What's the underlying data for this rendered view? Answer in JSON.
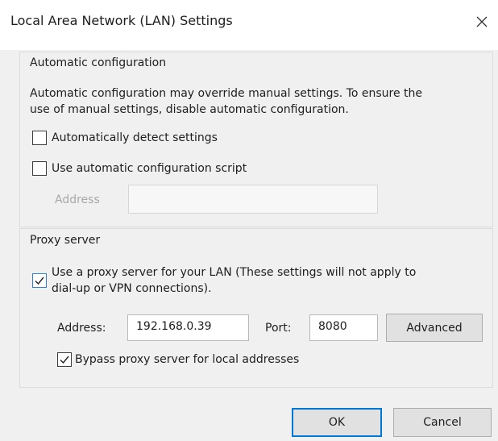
{
  "window": {
    "title": "Local Area Network (LAN) Settings"
  },
  "auto_config": {
    "legend": "Automatic configuration",
    "description_line1": "Automatic configuration may override manual settings.  To ensure the",
    "description_line2": "use of manual settings, disable automatic configuration.",
    "detect_label": "Automatically detect settings",
    "detect_checked": false,
    "script_label": "Use automatic configuration script",
    "script_checked": false,
    "address_label": "Address",
    "address_value": ""
  },
  "proxy": {
    "legend": "Proxy server",
    "use_proxy_label_line1": "Use a proxy server for your LAN (These settings will not apply to",
    "use_proxy_label_line2": "dial-up or VPN connections).",
    "use_proxy_checked": true,
    "address_label": "Address:",
    "address_value": "192.168.0.39",
    "port_label": "Port:",
    "port_value": "8080",
    "advanced_label": "Advanced",
    "bypass_label": "Bypass proxy server for local addresses",
    "bypass_checked": true
  },
  "buttons": {
    "ok_label": "OK",
    "cancel_label": "Cancel"
  },
  "colors": {
    "accent": "#0078d7",
    "checkbox_blue": "#2f7ed8"
  }
}
